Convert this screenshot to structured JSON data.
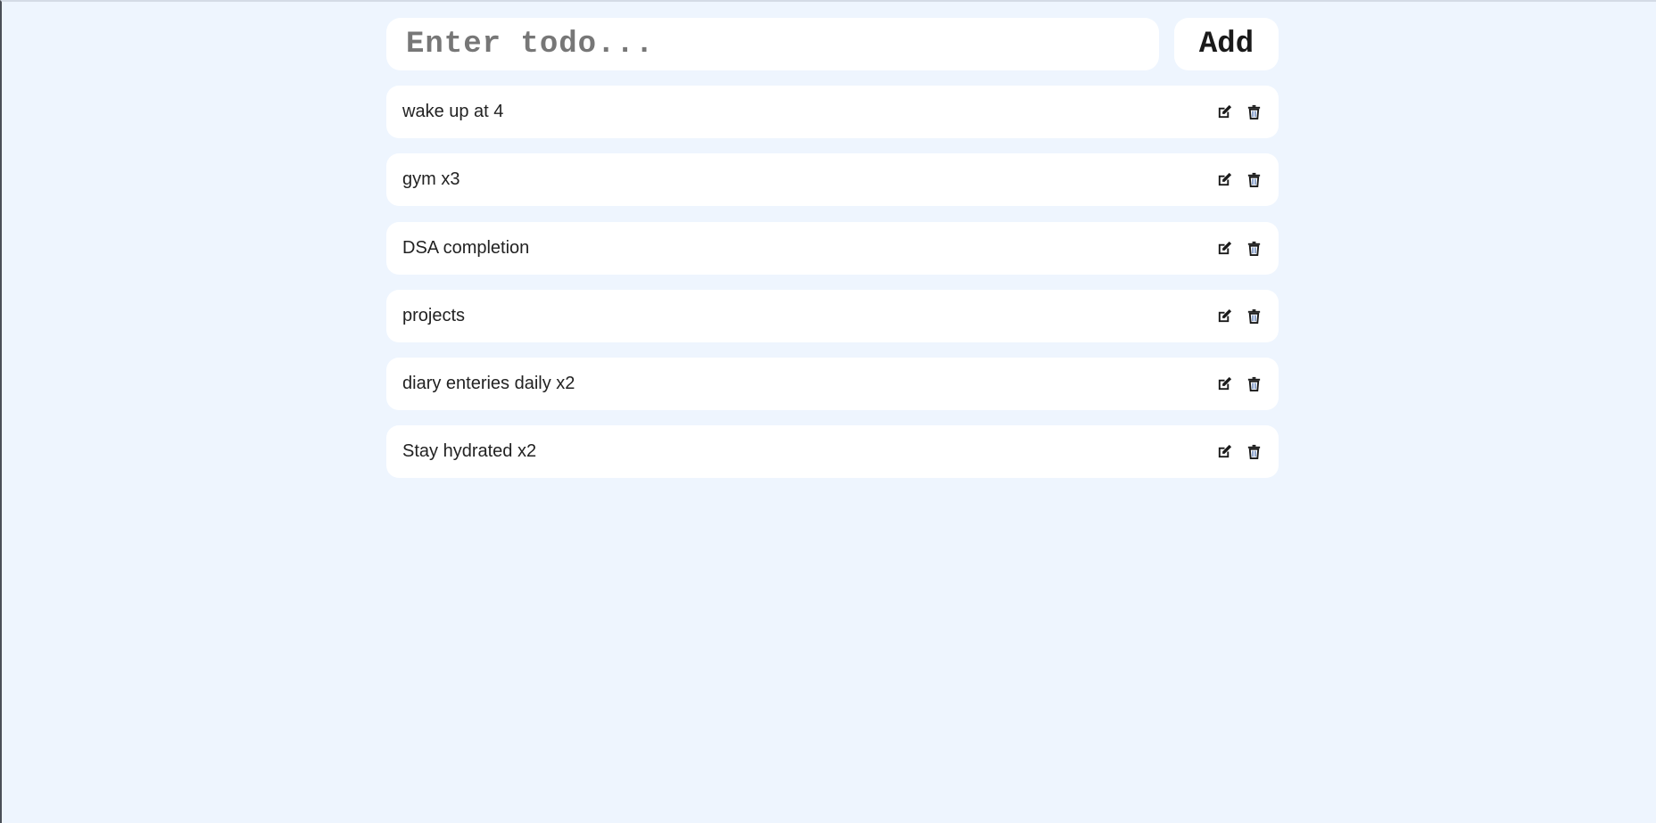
{
  "input": {
    "placeholder": "Enter todo...",
    "value": ""
  },
  "add_button": {
    "label": "Add"
  },
  "todos": [
    {
      "text": "wake up at 4"
    },
    {
      "text": "gym x3"
    },
    {
      "text": "DSA completion"
    },
    {
      "text": "projects"
    },
    {
      "text": "diary enteries daily x2"
    },
    {
      "text": "Stay hydrated x2"
    }
  ]
}
